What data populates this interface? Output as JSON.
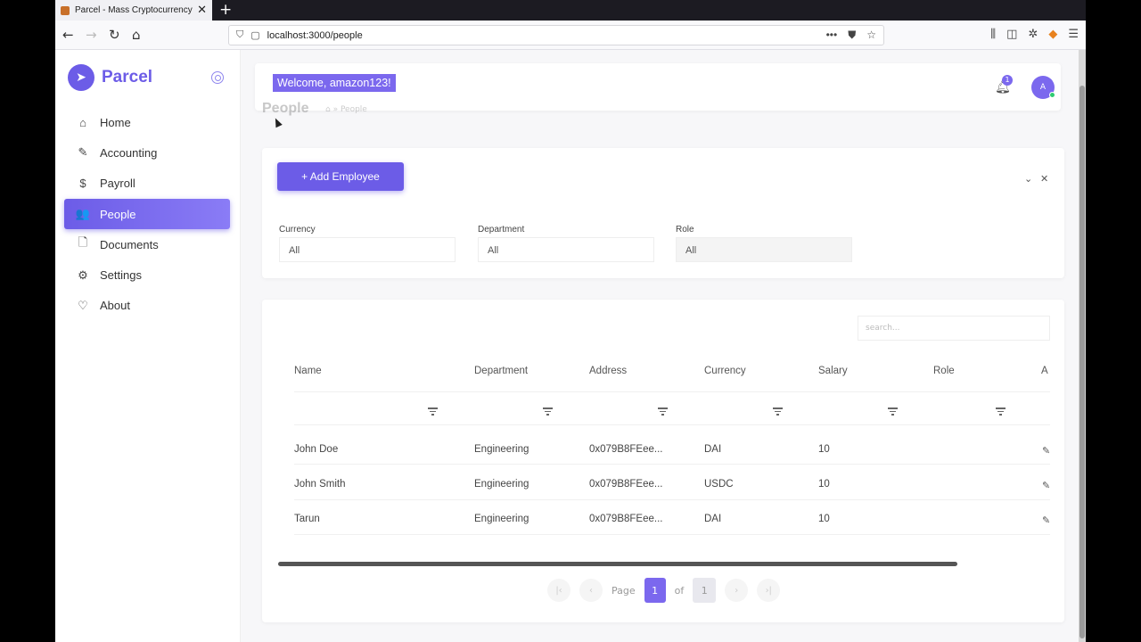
{
  "browser": {
    "tab_title": "Parcel - Mass Cryptocurrency P",
    "tab_close": "✕",
    "new_tab": "+",
    "url": "localhost:3000/people"
  },
  "app": {
    "brand": "Parcel"
  },
  "sidebar": {
    "items": [
      {
        "label": "Home",
        "icon": "home-icon",
        "glyph": "⌂"
      },
      {
        "label": "Accounting",
        "icon": "edit-icon",
        "glyph": "✎"
      },
      {
        "label": "Payroll",
        "icon": "dollar-icon",
        "glyph": "$"
      },
      {
        "label": "People",
        "icon": "users-icon",
        "glyph": "👥",
        "active": true
      },
      {
        "label": "Documents",
        "icon": "document-icon",
        "glyph": "🗋"
      },
      {
        "label": "Settings",
        "icon": "gear-icon",
        "glyph": "⚙"
      },
      {
        "label": "About",
        "icon": "heart-icon",
        "glyph": "♡"
      }
    ]
  },
  "header": {
    "welcome": "Welcome, amazon123!",
    "notification_count": "1",
    "avatar_initial": "A",
    "page_title": "People",
    "breadcrumb": "⌂  »  People"
  },
  "filters": {
    "add_button": "+ Add Employee",
    "fields": [
      {
        "label": "Currency",
        "value": "All"
      },
      {
        "label": "Department",
        "value": "All"
      },
      {
        "label": "Role",
        "value": "All"
      }
    ]
  },
  "table": {
    "search_placeholder": "search...",
    "columns": [
      "Name",
      "Department",
      "Address",
      "Currency",
      "Salary",
      "Role",
      "A"
    ],
    "rows": [
      {
        "name": "John Doe",
        "department": "Engineering",
        "address": "0x079B8FEee...",
        "currency": "DAI",
        "salary": "10",
        "role": ""
      },
      {
        "name": "John Smith",
        "department": "Engineering",
        "address": "0x079B8FEee...",
        "currency": "USDC",
        "salary": "10",
        "role": ""
      },
      {
        "name": "Tarun",
        "department": "Engineering",
        "address": "0x079B8FEee...",
        "currency": "DAI",
        "salary": "10",
        "role": ""
      }
    ]
  },
  "pagination": {
    "page_label": "Page",
    "current": "1",
    "of_label": "of",
    "total": "1"
  },
  "colors": {
    "accent": "#6c5ce7"
  }
}
